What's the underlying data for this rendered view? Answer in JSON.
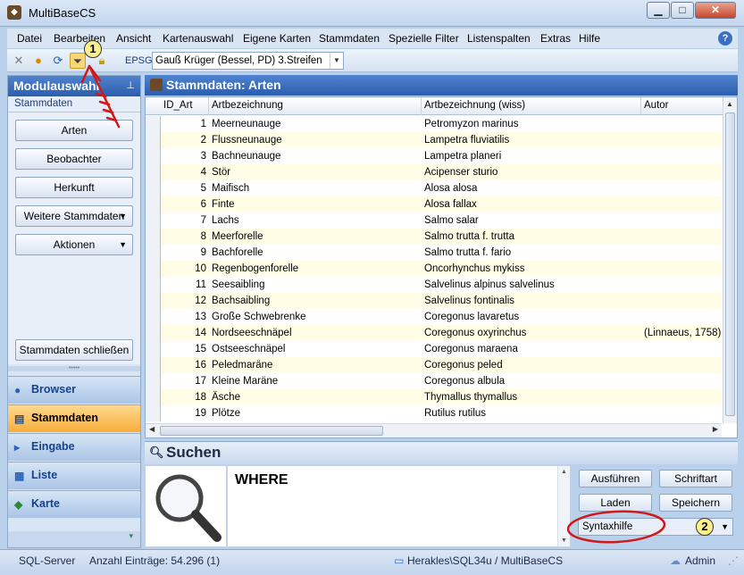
{
  "window": {
    "title": "MultiBaseCS",
    "minimize": "▁",
    "maximize": "□",
    "close": "✕"
  },
  "menu": [
    "Datei",
    "Bearbeiten",
    "Ansicht",
    "Kartenauswahl",
    "Eigene Karten",
    "Stammdaten",
    "Spezielle Filter",
    "Listenspalten",
    "Extras",
    "Hilfe"
  ],
  "toolbar": {
    "epsg_label": "EPSG",
    "projection_value": "Gauß Krüger (Bessel, PD) 3.Streifen",
    "callout_1": "1"
  },
  "sidebar": {
    "title": "Modulauswahl",
    "section": "Stammdaten",
    "buttons": [
      "Arten",
      "Beobachter",
      "Herkunft",
      "Weitere Stammdaten",
      "Aktionen"
    ],
    "close_button": "Stammdaten schließen",
    "nav": [
      "Browser",
      "Stammdaten",
      "Eingabe",
      "Liste",
      "Karte"
    ]
  },
  "main": {
    "title": "Stammdaten: Arten",
    "columns": [
      "ID_Art",
      "Artbezeichnung",
      "Artbezeichnung (wiss)",
      "Autor"
    ],
    "rows": [
      {
        "id": "1",
        "name": "Meerneunauge",
        "wiss": "Petromyzon marinus",
        "autor": ""
      },
      {
        "id": "2",
        "name": "Flussneunauge",
        "wiss": "Lampetra fluviatilis",
        "autor": ""
      },
      {
        "id": "3",
        "name": "Bachneunauge",
        "wiss": "Lampetra planeri",
        "autor": ""
      },
      {
        "id": "4",
        "name": "Stör",
        "wiss": "Acipenser sturio",
        "autor": ""
      },
      {
        "id": "5",
        "name": "Maifisch",
        "wiss": "Alosa alosa",
        "autor": ""
      },
      {
        "id": "6",
        "name": "Finte",
        "wiss": "Alosa fallax",
        "autor": ""
      },
      {
        "id": "7",
        "name": "Lachs",
        "wiss": "Salmo salar",
        "autor": ""
      },
      {
        "id": "8",
        "name": "Meerforelle",
        "wiss": "Salmo trutta f. trutta",
        "autor": ""
      },
      {
        "id": "9",
        "name": "Bachforelle",
        "wiss": "Salmo trutta f. fario",
        "autor": ""
      },
      {
        "id": "10",
        "name": "Regenbogenforelle",
        "wiss": "Oncorhynchus mykiss",
        "autor": ""
      },
      {
        "id": "11",
        "name": "Seesaibling",
        "wiss": "Salvelinus alpinus salvelinus",
        "autor": ""
      },
      {
        "id": "12",
        "name": "Bachsaibling",
        "wiss": "Salvelinus fontinalis",
        "autor": ""
      },
      {
        "id": "13",
        "name": "Große Schwebrenke",
        "wiss": "Coregonus lavaretus",
        "autor": ""
      },
      {
        "id": "14",
        "name": "Nordseeschnäpel",
        "wiss": "Coregonus oxyrinchus",
        "autor": "(Linnaeus, 1758)"
      },
      {
        "id": "15",
        "name": "Ostseeschnäpel",
        "wiss": "Coregonus maraena",
        "autor": ""
      },
      {
        "id": "16",
        "name": "Peledmaräne",
        "wiss": "Coregonus peled",
        "autor": ""
      },
      {
        "id": "17",
        "name": "Kleine Maräne",
        "wiss": "Coregonus albula",
        "autor": ""
      },
      {
        "id": "18",
        "name": "Äsche",
        "wiss": "Thymallus thymallus",
        "autor": ""
      },
      {
        "id": "19",
        "name": "Plötze",
        "wiss": "Rutilus rutilus",
        "autor": ""
      }
    ]
  },
  "search": {
    "title": "Suchen",
    "query": "WHERE",
    "buttons": {
      "run": "Ausführen",
      "font": "Schriftart",
      "load": "Laden",
      "save": "Speichern"
    },
    "syntax_help": "Syntaxhilfe",
    "callout_2": "2"
  },
  "status": {
    "server": "SQL-Server",
    "count": "Anzahl Einträge: 54.296 (1)",
    "connection": "Herakles\\SQL34u / MultiBaseCS",
    "user": "Admin"
  },
  "colors": {
    "header_blue": "#2b5fae",
    "active_nav": "#f7ae3b",
    "alt_row": "#fffde6",
    "annotation_red": "#d0191b"
  }
}
